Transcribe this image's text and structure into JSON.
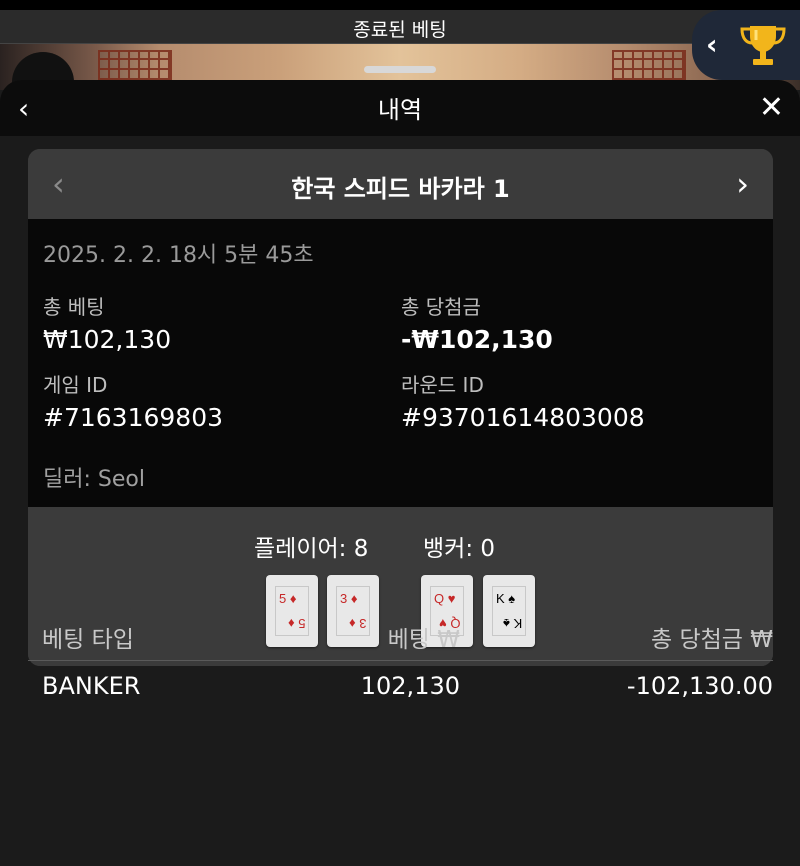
{
  "topbar": {
    "title": "종료된 베팅"
  },
  "trophy": {
    "chevron": "‹",
    "icon": "trophy-icon"
  },
  "panel": {
    "back": "‹",
    "title": "내역",
    "close": "✕"
  },
  "game": {
    "prev": "‹",
    "next": "›",
    "title": "한국 스피드 바카라 1",
    "datetime": "2025. 2. 2. 18시 5분 45초",
    "total_bet_label": "총 베팅",
    "total_bet_value": "₩102,130",
    "total_win_label": "총 당첨금",
    "total_win_value": "-₩102,130",
    "game_id_label": "게임 ID",
    "game_id_value": "#7163169803",
    "round_id_label": "라운드 ID",
    "round_id_value": "#93701614803008",
    "dealer": "딜러: Seol"
  },
  "result": {
    "player_label": "플레이어: 8",
    "banker_label": "뱅커: 0",
    "player_cards": [
      {
        "rank": "5",
        "suit": "♦",
        "color": "#c62828"
      },
      {
        "rank": "3",
        "suit": "♦",
        "color": "#c62828"
      }
    ],
    "banker_cards": [
      {
        "rank": "Q",
        "suit": "♥",
        "color": "#c62828"
      },
      {
        "rank": "K",
        "suit": "♠",
        "color": "#000000"
      }
    ]
  },
  "table": {
    "headers": [
      "베팅 타입",
      "베팅 ₩",
      "총 당첨금 ₩"
    ],
    "rows": [
      {
        "type": "BANKER",
        "bet": "102,130",
        "win": "-102,130.00"
      }
    ]
  }
}
